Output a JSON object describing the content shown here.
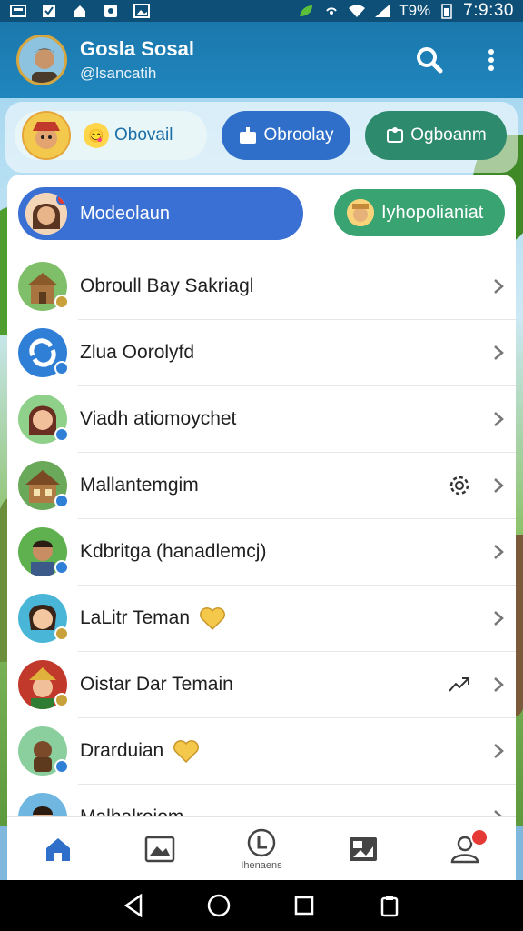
{
  "status_bar": {
    "battery": "T9%",
    "time": "7:9:30"
  },
  "header": {
    "title": "Gosla Sosal",
    "handle": "@lsancatih",
    "search_icon": "search-icon",
    "menu_icon": "more-vert-icon"
  },
  "chips": [
    {
      "label": "Obovail",
      "icon": "emoji-icon"
    },
    {
      "label": "Obroolay",
      "icon": "inbox-icon"
    },
    {
      "label": "Ogboanm",
      "icon": "puzzle-icon"
    }
  ],
  "tabs": [
    {
      "label": "Modeolaun"
    },
    {
      "label": "Iyhopolianiat"
    }
  ],
  "list": [
    {
      "label": "Obroull Bay Sakriagl",
      "extra": ""
    },
    {
      "label": "Zlua Oorolyfd",
      "extra": ""
    },
    {
      "label": "Viadh atiomoychet",
      "extra": ""
    },
    {
      "label": "Mallantemgim",
      "extra": "settings-icon"
    },
    {
      "label": "Kdbritga (hanadlemcj)",
      "extra": ""
    },
    {
      "label": "LaLitr Teman",
      "extra": "heart-emoji-icon"
    },
    {
      "label": "Oistar Dar Temain",
      "extra": "share-icon"
    },
    {
      "label": "Drarduian",
      "extra": "heart-emoji-icon"
    },
    {
      "label": "Malhalroiom",
      "extra": ""
    }
  ],
  "bottom_nav": [
    {
      "icon": "home-icon",
      "label": ""
    },
    {
      "icon": "photos-icon",
      "label": ""
    },
    {
      "icon": "timeline-icon",
      "label": "Ihenaens"
    },
    {
      "icon": "gallery-icon",
      "label": ""
    },
    {
      "icon": "profile-icon",
      "label": ""
    }
  ],
  "colors": {
    "status_bar": "#0e4f78",
    "app_bar": "#1b78ad",
    "primary_pill": "#3a6fd3",
    "green_pill": "#3aa372",
    "badge_red": "#e53935"
  }
}
